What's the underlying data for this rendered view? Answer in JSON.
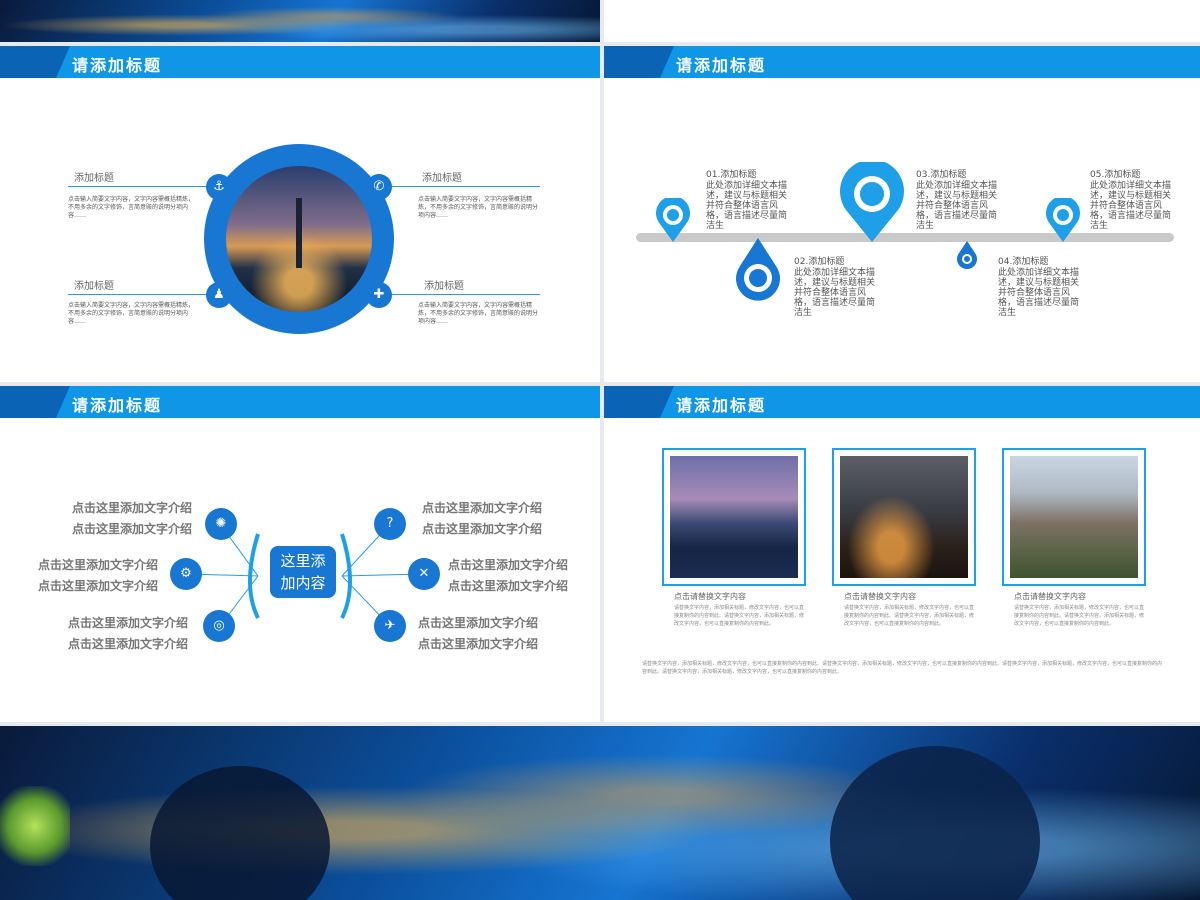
{
  "slides": {
    "anchor": {
      "title": "请添加标题",
      "left_top_label": "添加标题",
      "left_top_text": "点击输入简要文字内容，文字内容需概括精炼，不用多余的文字修饰，言简意赅的说明分项内容……",
      "left_bottom_label": "添加标题",
      "left_bottom_text": "点击输入简要文字内容，文字内容需概括精炼，不用多余的文字修饰，言简意赅的说明分项内容……",
      "right_top_label": "添加标题",
      "right_top_text": "点击输入简要文字内容，文字内容需概括精炼，不用多余的文字修饰，言简意赅的说明分项内容……",
      "right_bottom_label": "添加标题",
      "right_bottom_text": "点击输入简要文字内容，文字内容需概括精炼，不用多余的文字修饰，言简意赅的说明分项内容……"
    },
    "timeline": {
      "title": "请添加标题",
      "items": [
        {
          "label": "01.添加标题",
          "text": "此处添加详细文本描述，建议与标题相关并符合整体语言风格，语言描述尽量简洁生"
        },
        {
          "label": "02.添加标题",
          "text": "此处添加详细文本描述，建议与标题相关并符合整体语言风格，语言描述尽量简洁生"
        },
        {
          "label": "03.添加标题",
          "text": "此处添加详细文本描述，建议与标题相关并符合整体语言风格，语言描述尽量简洁生"
        },
        {
          "label": "04.添加标题",
          "text": "此处添加详细文本描述，建议与标题相关并符合整体语言风格，语言描述尽量简洁生"
        },
        {
          "label": "05.添加标题",
          "text": "此处添加详细文本描述，建议与标题相关并符合整体语言风格，语言描述尽量简洁生"
        }
      ]
    },
    "mindmap": {
      "title": "请添加标题",
      "center": "这里添加内容",
      "line": "点击这里添加文字介绍"
    },
    "photos": {
      "title": "请添加标题",
      "captions": [
        "点击请替换文字内容",
        "点击请替换文字内容",
        "点击请替换文字内容"
      ],
      "body": "请替换文字内容，添加相关标题，修改文字内容，也可以直接复制你的内容到此。请替换文字内容，添加相关标题，修改文字内容，也可以直接复制你的内容到此。",
      "footer": "请替换文字内容，添加相关标题，修改文字内容，也可以直接复制你的内容到此。请替换文字内容，添加相关标题，修改文字内容，也可以直接复制你的内容到此。请替换文字内容，添加相关标题，修改文字内容，也可以直接复制你的内容到此。请替换文字内容，添加相关标题，修改文字内容，也可以直接复制你的内容到此。"
    }
  },
  "colors": {
    "accent": "#0f96e6",
    "dark_accent": "#0a63b5",
    "icon": "#1877d2"
  }
}
